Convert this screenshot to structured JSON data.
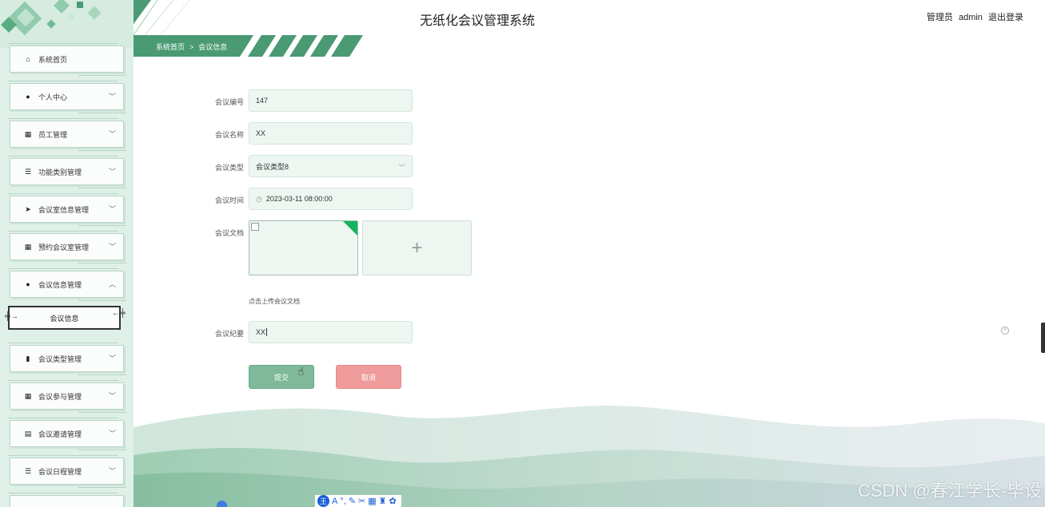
{
  "header": {
    "title": "无纸化会议管理系统",
    "role": "管理员",
    "username": "admin",
    "logout": "退出登录"
  },
  "breadcrumb": {
    "home": "系统首页",
    "separator": ">",
    "current": "会议信息"
  },
  "sidebar": {
    "items": [
      {
        "label": "系统首页",
        "icon": "home-icon",
        "has_arrow": false
      },
      {
        "label": "个人中心",
        "icon": "user-icon",
        "has_arrow": true
      },
      {
        "label": "员工管理",
        "icon": "grid-icon",
        "has_arrow": true
      },
      {
        "label": "功能类别管理",
        "icon": "list-icon",
        "has_arrow": true
      },
      {
        "label": "会议室信息管理",
        "icon": "send-icon",
        "has_arrow": true
      },
      {
        "label": "预约会议室管理",
        "icon": "grid-icon",
        "has_arrow": true
      },
      {
        "label": "会议信息管理",
        "icon": "user-icon",
        "has_arrow": true,
        "expanded": true
      },
      {
        "label": "会议类型管理",
        "icon": "bar-chart-icon",
        "has_arrow": true
      },
      {
        "label": "会议参与管理",
        "icon": "grid-icon",
        "has_arrow": true
      },
      {
        "label": "会议邀请管理",
        "icon": "document-icon",
        "has_arrow": true
      },
      {
        "label": "会议日程管理",
        "icon": "list-icon",
        "has_arrow": true
      }
    ],
    "sub_item": "会议信息"
  },
  "form": {
    "meeting_no": {
      "label": "会议编号",
      "value": "147"
    },
    "meeting_name": {
      "label": "会议名称",
      "value": "XX"
    },
    "meeting_type": {
      "label": "会议类型",
      "value": "会议类型8"
    },
    "meeting_time": {
      "label": "会议时间",
      "value": "2023-03-11 08:00:00"
    },
    "meeting_doc": {
      "label": "会议文档",
      "hint": "点击上传会议文档",
      "add": "+"
    },
    "meeting_summary": {
      "label": "会议纪要",
      "value": "XX"
    },
    "submit": "提交",
    "cancel": "取消"
  },
  "watermark": "CSDN @春江学长-毕设",
  "colors": {
    "primary_green": "#4a9a74",
    "submit_bg": "#7fb99a",
    "cancel_bg": "#ef9b9b",
    "sidebar_bg": "#dff0e8"
  }
}
